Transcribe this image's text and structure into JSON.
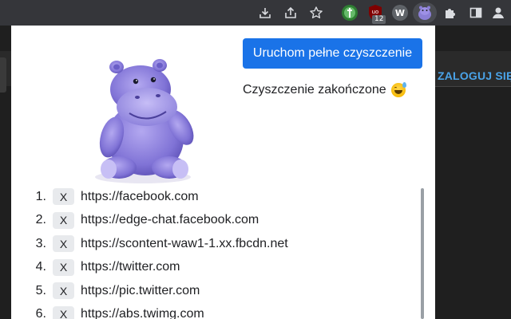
{
  "toolbar": {
    "icons": [
      "download-icon",
      "share-icon",
      "star-icon",
      "green-extension-icon",
      "ublock-icon",
      "w-extension-icon",
      "hippo-extension-icon",
      "puzzle-icon",
      "sidebar-icon",
      "profile-icon"
    ],
    "ublock_badge": "12",
    "w_letter": "W"
  },
  "background_page": {
    "login_label": "ZALOGUJ SIĘ"
  },
  "popup": {
    "run_button_label": "Uruchom pełne czyszczenie",
    "status_text": "Czyszczenie zakończone",
    "status_emoji": "grinning-sweat-emoji",
    "accent_color": "#1a73e8",
    "remove_label": "X",
    "sites": [
      {
        "num": "1.",
        "url": "https://facebook.com"
      },
      {
        "num": "2.",
        "url": "https://edge-chat.facebook.com"
      },
      {
        "num": "3.",
        "url": "https://scontent-waw1-1.xx.fbcdn.net"
      },
      {
        "num": "4.",
        "url": "https://twitter.com"
      },
      {
        "num": "5.",
        "url": "https://pic.twitter.com"
      },
      {
        "num": "6.",
        "url": "https://abs.twimg.com"
      }
    ]
  }
}
